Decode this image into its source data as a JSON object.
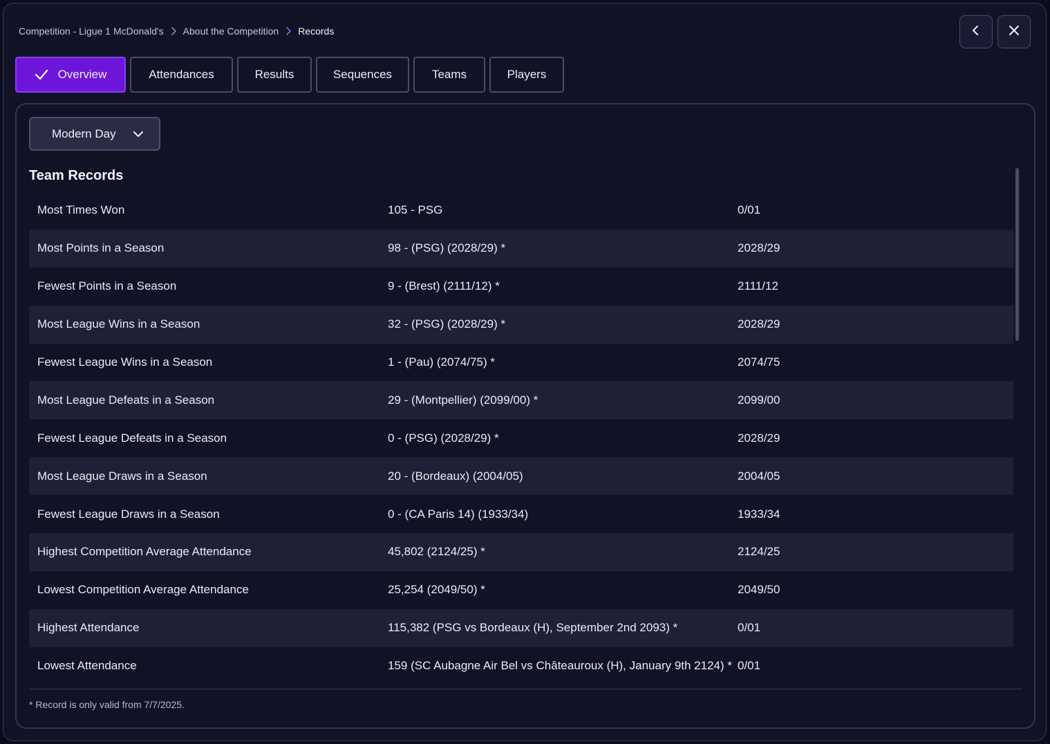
{
  "breadcrumb": {
    "items": [
      "Competition - Ligue 1 McDonald's",
      "About the Competition",
      "Records"
    ]
  },
  "header": {
    "back_icon": "chevron-left-icon",
    "close_icon": "close-icon"
  },
  "tabs": [
    {
      "label": "Overview",
      "active": true,
      "icon": "check-icon"
    },
    {
      "label": "Attendances",
      "active": false
    },
    {
      "label": "Results",
      "active": false
    },
    {
      "label": "Sequences",
      "active": false
    },
    {
      "label": "Teams",
      "active": false
    },
    {
      "label": "Players",
      "active": false
    }
  ],
  "filter": {
    "selected": "Modern Day",
    "icon": "chevron-down-icon"
  },
  "section": {
    "title": "Team Records"
  },
  "records": [
    {
      "label": "Most Times Won",
      "value": "105 - PSG",
      "season": "0/01"
    },
    {
      "label": "Most Points in a Season",
      "value": "98 - (PSG) (2028/29) *",
      "season": "2028/29"
    },
    {
      "label": "Fewest Points in a Season",
      "value": "9 - (Brest) (2111/12) *",
      "season": "2111/12"
    },
    {
      "label": "Most League Wins in a Season",
      "value": "32 - (PSG) (2028/29) *",
      "season": "2028/29"
    },
    {
      "label": "Fewest League Wins in a Season",
      "value": "1 - (Pau) (2074/75) *",
      "season": "2074/75"
    },
    {
      "label": "Most League Defeats in a Season",
      "value": "29 - (Montpellier) (2099/00) *",
      "season": "2099/00"
    },
    {
      "label": "Fewest League Defeats in a Season",
      "value": "0 - (PSG) (2028/29) *",
      "season": "2028/29"
    },
    {
      "label": "Most League Draws in a Season",
      "value": "20 - (Bordeaux) (2004/05)",
      "season": "2004/05"
    },
    {
      "label": "Fewest League Draws in a Season",
      "value": "0 - (CA Paris 14) (1933/34)",
      "season": "1933/34"
    },
    {
      "label": "Highest Competition Average Attendance",
      "value": "45,802 (2124/25) *",
      "season": "2124/25"
    },
    {
      "label": "Lowest Competition Average Attendance",
      "value": "25,254 (2049/50) *",
      "season": "2049/50"
    },
    {
      "label": "Highest Attendance",
      "value": "115,382 (PSG vs Bordeaux (H), September 2nd 2093) *",
      "season": "0/01"
    },
    {
      "label": "Lowest Attendance",
      "value": "159 (SC Aubagne Air Bel vs Châteauroux (H), January 9th 2124) *",
      "season": "0/01"
    }
  ],
  "footnote": "* Record is only valid from 7/7/2025.",
  "colors": {
    "accent": "#6d16d9",
    "background": "#111226",
    "row_alt": "#1f2036"
  }
}
